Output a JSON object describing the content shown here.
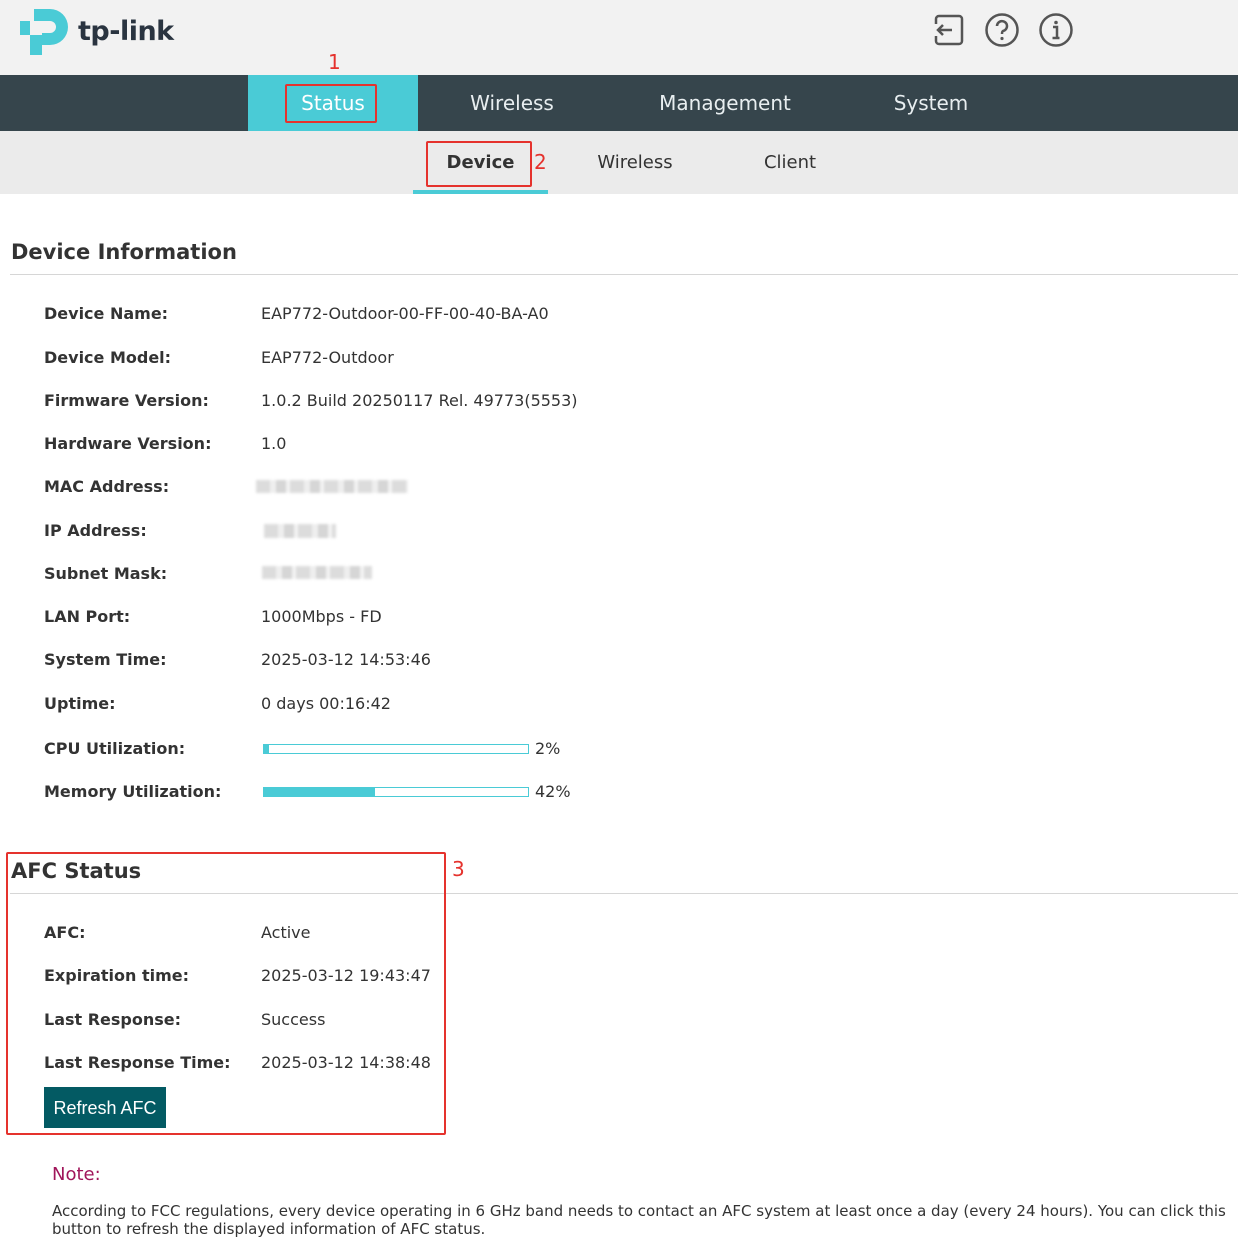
{
  "brand": {
    "name": "tp-link",
    "color": "#4acbd6"
  },
  "header_icons": [
    {
      "name": "logout-icon"
    },
    {
      "name": "help-icon"
    },
    {
      "name": "info-icon"
    }
  ],
  "main_nav": {
    "items": [
      {
        "label": "Status",
        "active": true
      },
      {
        "label": "Wireless"
      },
      {
        "label": "Management"
      },
      {
        "label": "System"
      }
    ]
  },
  "sub_nav": {
    "items": [
      {
        "label": "Device",
        "active": true
      },
      {
        "label": "Wireless"
      },
      {
        "label": "Client"
      }
    ]
  },
  "device_info": {
    "title": "Device Information",
    "rows": [
      {
        "label": "Device Name",
        "value": "EAP772-Outdoor-00-FF-00-40-BA-A0"
      },
      {
        "label": "Device Model",
        "value": "EAP772-Outdoor"
      },
      {
        "label": "Firmware Version",
        "value": "1.0.2 Build 20250117 Rel. 49773(5553)"
      },
      {
        "label": "Hardware Version",
        "value": "1.0"
      },
      {
        "label": "MAC Address",
        "value": ""
      },
      {
        "label": "IP Address",
        "value": ""
      },
      {
        "label": "Subnet Mask",
        "value": ""
      },
      {
        "label": "LAN Port",
        "value": "1000Mbps - FD"
      },
      {
        "label": "System Time",
        "value": "2025-03-12 14:53:46"
      },
      {
        "label": "Uptime",
        "value": "0 days 00:16:42"
      },
      {
        "label": "CPU Utilization",
        "value": "2%",
        "fraction": 0.02
      },
      {
        "label": "Memory Utilization",
        "value": "42%",
        "fraction": 0.42
      }
    ]
  },
  "afc_status": {
    "title": "AFC Status",
    "rows": [
      {
        "label": "AFC",
        "value": "Active"
      },
      {
        "label": "Expiration time",
        "value": "2025-03-12 19:43:47"
      },
      {
        "label": "Last Response",
        "value": "Success"
      },
      {
        "label": "Last Response Time",
        "value": "2025-03-12 14:38:48"
      }
    ],
    "refresh_label": "Refresh AFC"
  },
  "note": {
    "title": "Note:",
    "text": "According to FCC regulations, every device operating in 6 GHz band needs to contact an AFC system at least once a day (every 24 hours). You can click this button to refresh the displayed information of AFC status."
  },
  "annotations": [
    {
      "number": "1"
    },
    {
      "number": "2"
    },
    {
      "number": "3"
    }
  ]
}
